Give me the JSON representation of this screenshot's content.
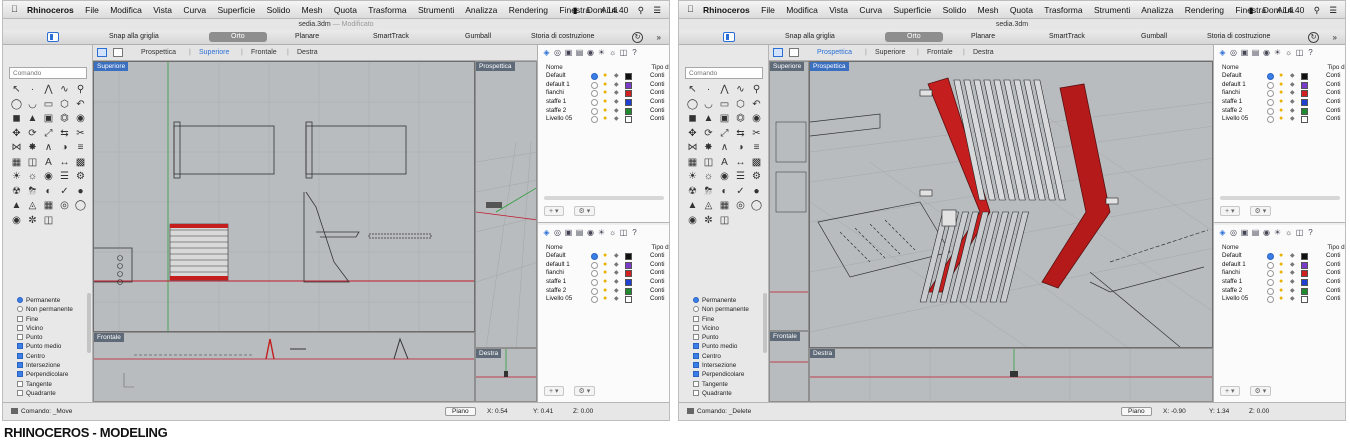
{
  "caption": "RHINOCEROS - MODELING",
  "colors": {
    "accent": "#2b6fd6",
    "axis_red": "#c0182a",
    "axis_green": "#2e9d3a",
    "chair_red": "#c41e1e"
  },
  "screens": [
    {
      "menubar": {
        "apple_icon": "apple-icon",
        "app_name": "Rhinoceros",
        "menus": [
          "File",
          "Modifica",
          "Vista",
          "Curva",
          "Superficie",
          "Solido",
          "Mesh",
          "Quota",
          "Trasforma",
          "Strumenti",
          "Analizza",
          "Rendering",
          "Finestra",
          "Aiuti"
        ],
        "clock": "Dom 14.40",
        "status_icons": [
          "battery-icon",
          "search-icon",
          "list-icon"
        ]
      },
      "window_title": "sedia.3dm",
      "window_subtitle": "Modificato",
      "toolbar": {
        "snap": "Snap alla griglia",
        "orto": "Orto",
        "planare": "Planare",
        "smarttrack": "SmartTrack",
        "gumball": "Gumball",
        "storia": "Storia di costruzione",
        "more": "»"
      },
      "viewport_tabs": [
        "Prospettica",
        "Superiore",
        "Frontale",
        "Destra"
      ],
      "active_tab": 1,
      "viewports": {
        "big": "Superiore",
        "top_right": "Prospettica",
        "bottom_left": "Frontale",
        "bottom_right": "Destra"
      },
      "command_placeholder": "Comando",
      "snaps": [
        {
          "label": "Permanente",
          "kind": "radio",
          "on": true
        },
        {
          "label": "Non permanente",
          "kind": "radio",
          "on": false
        },
        {
          "label": "Fine",
          "kind": "check",
          "on": false
        },
        {
          "label": "Vicino",
          "kind": "check",
          "on": false
        },
        {
          "label": "Punto",
          "kind": "check",
          "on": false
        },
        {
          "label": "Punto medio",
          "kind": "check",
          "on": true
        },
        {
          "label": "Centro",
          "kind": "check",
          "on": true
        },
        {
          "label": "Intersezione",
          "kind": "check",
          "on": true
        },
        {
          "label": "Perpendicolare",
          "kind": "check",
          "on": true
        },
        {
          "label": "Tangente",
          "kind": "check",
          "on": false
        },
        {
          "label": "Quadrante",
          "kind": "check",
          "on": false
        }
      ],
      "layers_header": {
        "name": "Nome",
        "type": "Tipo di"
      },
      "layers": [
        {
          "name": "Default",
          "color": "#111111",
          "type": "Conti",
          "current": true
        },
        {
          "name": "default 1",
          "color": "#7a3cc8",
          "type": "Conti",
          "current": false
        },
        {
          "name": "fianchi",
          "color": "#d21f1f",
          "type": "Conti",
          "current": false
        },
        {
          "name": "staffe 1",
          "color": "#1f3fd2",
          "type": "Conti",
          "current": false
        },
        {
          "name": "staffe 2",
          "color": "#1f8a2e",
          "type": "Conti",
          "current": false
        },
        {
          "name": "Livello 05",
          "color": "#ffffff",
          "type": "Conti",
          "current": false
        }
      ],
      "status": {
        "command": "Comando: _Move",
        "plane": "Piano",
        "x": "X: 0.54",
        "y": "Y: 0.41",
        "z": "Z: 0.00"
      }
    },
    {
      "menubar": {
        "apple_icon": "apple-icon",
        "app_name": "Rhinoceros",
        "menus": [
          "File",
          "Modifica",
          "Vista",
          "Curva",
          "Superficie",
          "Solido",
          "Mesh",
          "Quota",
          "Trasforma",
          "Strumenti",
          "Analizza",
          "Rendering",
          "Finestra",
          "Aiuti"
        ],
        "clock": "Dom 14.40",
        "status_icons": [
          "battery-icon",
          "search-icon",
          "list-icon"
        ]
      },
      "window_title": "sedia.3dm",
      "window_subtitle": "",
      "toolbar": {
        "snap": "Snap alla griglia",
        "orto": "Orto",
        "planare": "Planare",
        "smarttrack": "SmartTrack",
        "gumball": "Gumball",
        "storia": "Storia di costruzione",
        "more": "»"
      },
      "viewport_tabs": [
        "Prospettica",
        "Superiore",
        "Frontale",
        "Destra"
      ],
      "active_tab": 0,
      "viewports": {
        "big": "Prospettica",
        "top_left": "Superiore",
        "bottom_left": "Frontale",
        "bottom_right": "Destra"
      },
      "command_placeholder": "Comando",
      "snaps": [
        {
          "label": "Permanente",
          "kind": "radio",
          "on": true
        },
        {
          "label": "Non permanente",
          "kind": "radio",
          "on": false
        },
        {
          "label": "Fine",
          "kind": "check",
          "on": false
        },
        {
          "label": "Vicino",
          "kind": "check",
          "on": false
        },
        {
          "label": "Punto",
          "kind": "check",
          "on": false
        },
        {
          "label": "Punto medio",
          "kind": "check",
          "on": true
        },
        {
          "label": "Centro",
          "kind": "check",
          "on": true
        },
        {
          "label": "Intersezione",
          "kind": "check",
          "on": true
        },
        {
          "label": "Perpendicolare",
          "kind": "check",
          "on": true
        },
        {
          "label": "Tangente",
          "kind": "check",
          "on": false
        },
        {
          "label": "Quadrante",
          "kind": "check",
          "on": false
        }
      ],
      "layers_header": {
        "name": "Nome",
        "type": "Tipo di"
      },
      "layers": [
        {
          "name": "Default",
          "color": "#111111",
          "type": "Conti",
          "current": true
        },
        {
          "name": "default 1",
          "color": "#7a3cc8",
          "type": "Conti",
          "current": false
        },
        {
          "name": "fianchi",
          "color": "#d21f1f",
          "type": "Conti",
          "current": false
        },
        {
          "name": "staffe 1",
          "color": "#1f3fd2",
          "type": "Conti",
          "current": false
        },
        {
          "name": "staffe 2",
          "color": "#1f8a2e",
          "type": "Conti",
          "current": false
        },
        {
          "name": "Livello 05",
          "color": "#ffffff",
          "type": "Conti",
          "current": false
        }
      ],
      "status": {
        "command": "Comando: _Delete",
        "plane": "Piano",
        "x": "X: -0.90",
        "y": "Y: 1.34",
        "z": "Z: 0.00"
      }
    }
  ]
}
